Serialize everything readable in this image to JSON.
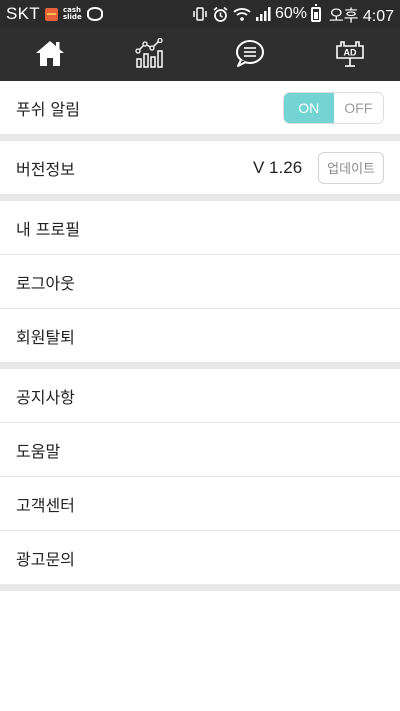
{
  "status_bar": {
    "carrier": "SKT",
    "app_label_top": "cash",
    "app_label_bottom": "slide",
    "battery_percent": "60%",
    "time": "오후 4:07"
  },
  "tabs": [
    {
      "name": "home",
      "icon": "home-icon"
    },
    {
      "name": "stats",
      "icon": "chart-icon"
    },
    {
      "name": "chat",
      "icon": "chat-icon"
    },
    {
      "name": "ad",
      "icon": "ad-icon",
      "icon_text": "AD"
    }
  ],
  "settings": {
    "push": {
      "label": "푸쉬 알림",
      "on_label": "ON",
      "off_label": "OFF",
      "state": "on"
    },
    "version": {
      "label": "버전정보",
      "value": "V 1.26",
      "update_label": "업데이트"
    },
    "account": {
      "profile": "내 프로필",
      "logout": "로그아웃",
      "withdraw": "회원탈퇴"
    },
    "support": {
      "notice": "공지사항",
      "help": "도움말",
      "customer_center": "고객센터",
      "ad_inquiry": "광고문의"
    }
  },
  "colors": {
    "toggle_on": "#74d3d3",
    "bar_bg": "#2f2f2f"
  }
}
